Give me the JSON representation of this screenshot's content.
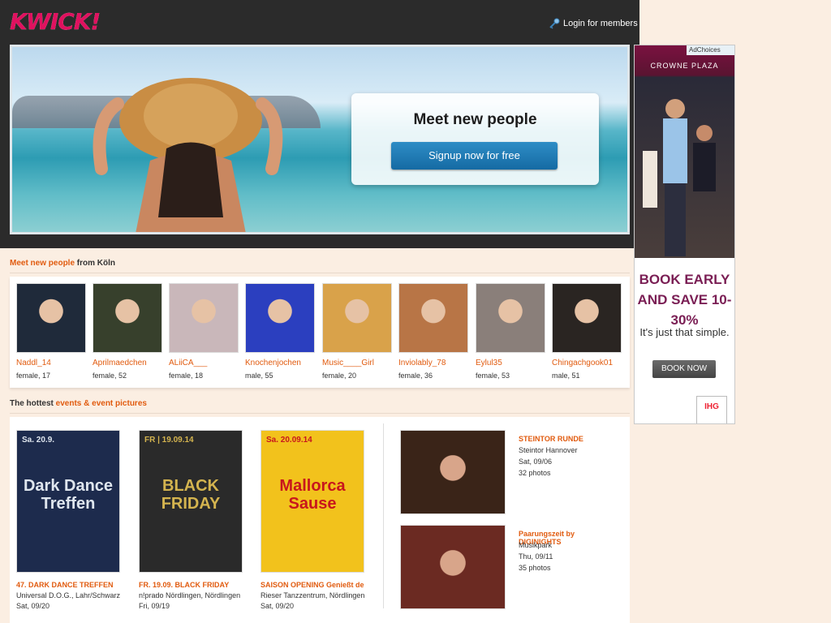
{
  "header": {
    "logo_text": "KWICK!",
    "login_label": "Login for members",
    "colors": {
      "brand": "#e0115f",
      "accent": "#e15b0f",
      "button": "#1f7db8"
    }
  },
  "hero": {
    "title": "Meet new people",
    "signup_label": "Signup now for free"
  },
  "people": {
    "title_hl": "Meet new people",
    "title_rest": " from Köln",
    "items": [
      {
        "name": "Naddl_14",
        "meta": "female, 17",
        "bg": "#1f2a3a"
      },
      {
        "name": "Aprilmaedchen",
        "meta": "female, 52",
        "bg": "#37402c"
      },
      {
        "name": "ALiiCA___",
        "meta": "female, 18",
        "bg": "#c9b7ba"
      },
      {
        "name": "Knochenjochen",
        "meta": "male, 55",
        "bg": "#2b3fbf"
      },
      {
        "name": "Music____Girl",
        "meta": "female, 20",
        "bg": "#d9a24a"
      },
      {
        "name": "Inviolably_78",
        "meta": "female, 36",
        "bg": "#b87546"
      },
      {
        "name": "Eylul35",
        "meta": "female, 53",
        "bg": "#8a7f7a"
      },
      {
        "name": "Chingachgook01",
        "meta": "male, 51",
        "bg": "#2a2522"
      }
    ]
  },
  "events": {
    "title_pre": "The hottest ",
    "title_hl": "events & event pictures",
    "items": [
      {
        "title": "47. DARK DANCE TREFFEN",
        "place": "Universal D.O.G., Lahr/Schwarzw",
        "date": "Sat, 09/20",
        "poster_text": "Dark Dance Treffen",
        "poster_date": "Sa. 20.9.",
        "bg": "#1d2b4d",
        "fg": "#dfe6ee"
      },
      {
        "title": "FR. 19.09. BLACK FRIDAY",
        "place": "n!prado Nördlingen, Nördlingen",
        "date": "Fri, 09/19",
        "poster_text": "BLACK FRIDAY",
        "poster_date": "FR | 19.09.14",
        "bg": "#2a2a2a",
        "fg": "#d4b44f"
      },
      {
        "title": "SAISON OPENING Genießt den",
        "place": "Rieser Tanzzentrum, Nördlingen",
        "date": "Sat, 09/20",
        "poster_text": "Mallorca Sause",
        "poster_date": "Sa. 20.09.14",
        "bg": "#f2c21c",
        "fg": "#c8161d"
      }
    ],
    "galleries": [
      {
        "title": "STEINTOR RUNDE",
        "location": "Steintor Hannover",
        "date": "Sat, 09/06",
        "count": "32 photos",
        "bg": "#3a2418"
      },
      {
        "title": "Paarungszeit by DIGINIGHTS",
        "location": "Musikpark",
        "date": "Thu, 09/11",
        "count": "35 photos",
        "bg": "#6b2a22"
      }
    ]
  },
  "ad": {
    "adchoices": "AdChoices",
    "brand": "CROWNE PLAZA",
    "headline": "BOOK EARLY AND SAVE 10-30%",
    "sub": "It's just that simple.",
    "button": "BOOK NOW",
    "logo": "IHG"
  }
}
